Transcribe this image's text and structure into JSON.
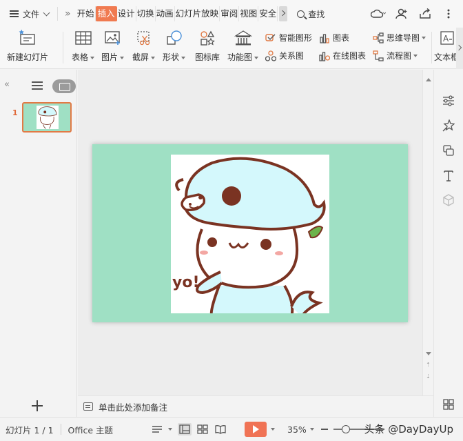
{
  "menubar": {
    "file_label": "文件",
    "tabs": [
      "开始",
      "插入",
      "设计",
      "切换",
      "动画",
      "幻灯片放映",
      "审阅",
      "视图",
      "安全"
    ],
    "active_tab": "插入",
    "search_label": "查找"
  },
  "ribbon": {
    "new_slide": "新建幻灯片",
    "table": "表格",
    "picture": "图片",
    "screenshot": "截屏",
    "shape": "形状",
    "icon_library": "图标库",
    "function_chart": "功能图",
    "smart_art": "智能图形",
    "relation": "关系图",
    "chart": "图表",
    "online_chart": "在线图表",
    "mind_map": "思维导图",
    "flowchart": "流程图",
    "textbox": "文本框"
  },
  "left_panel": {
    "slide_number": "1"
  },
  "notes": {
    "placeholder": "单击此处添加备注"
  },
  "statusbar": {
    "slide_counter": "幻灯片 1 / 1",
    "theme": "Office 主题",
    "zoom": "35%",
    "watermark": "头条 @DayDayUp"
  },
  "colors": {
    "accent": "#f07a50",
    "slide_bg": "#9fe0c4",
    "play": "#f07355"
  }
}
